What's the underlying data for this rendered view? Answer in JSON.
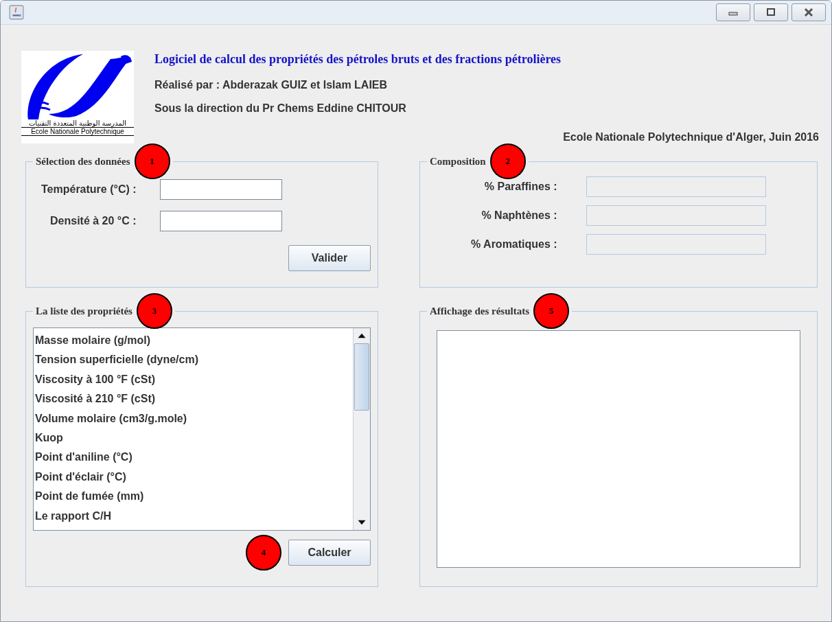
{
  "logo": {
    "arabic": "المدرسة الوطنية المتعددة التقنيات",
    "latin": "Ecole Nationale Polytechnique"
  },
  "header": {
    "title": "Logiciel de calcul des propriétés des pétroles bruts et des fractions pétrolières",
    "authors": "Réalisé par : Abderazak GUIZ et Islam  LAIEB",
    "direction": "Sous la direction du Pr Chems Eddine CHITOUR",
    "school": "Ecole Nationale Polytechnique d'Alger, Juin 2016"
  },
  "selection": {
    "legend": "Sélection des données",
    "badge": "1",
    "fields": [
      {
        "label": "Température (°C) :",
        "disabled": false
      },
      {
        "label": "Densité à 20 °C :",
        "disabled": false
      }
    ],
    "button": "Valider"
  },
  "composition": {
    "legend": "Composition",
    "badge": "2",
    "fields": [
      {
        "label": "% Paraffines :",
        "disabled": true
      },
      {
        "label": "% Naphtènes :",
        "disabled": true
      },
      {
        "label": "% Aromatiques :",
        "disabled": true
      }
    ]
  },
  "properties": {
    "legend": "La liste des propriétés",
    "badge": "3",
    "items": [
      {
        "label": "Masse molaire (g/mol)",
        "selected": false
      },
      {
        "label": "Tension superficielle (dyne/cm)",
        "selected": false
      },
      {
        "label": "Viscosity à 100 °F (cSt)",
        "selected": false
      },
      {
        "label": "Viscosité à 210 °F (cSt)",
        "selected": false
      },
      {
        "label": "Volume molaire (cm3/g.mole)",
        "selected": false
      },
      {
        "label": "Kuop",
        "selected": false
      },
      {
        "label": "Point d'aniline (°C)",
        "selected": false
      },
      {
        "label": "Point d'éclair (°C)",
        "selected": false
      },
      {
        "label": "Point de fumée (mm)",
        "selected": false
      },
      {
        "label": "Le rapport C/H",
        "selected": false
      }
    ],
    "button_badge": "4",
    "button": "Calculer"
  },
  "results": {
    "legend": "Affichage des résultats",
    "badge": "5"
  }
}
